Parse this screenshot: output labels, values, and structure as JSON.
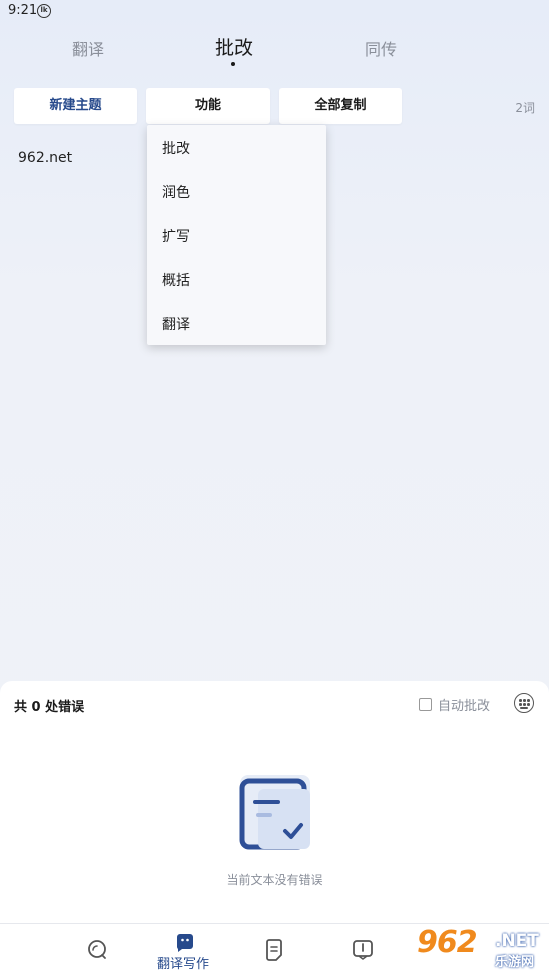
{
  "status_bar": {
    "time": "9:21",
    "indicator_glyph": "lk"
  },
  "top_tabs": [
    {
      "label": "翻译",
      "active": false
    },
    {
      "label": "批改",
      "active": true
    },
    {
      "label": "同传",
      "active": false
    }
  ],
  "toolbar": {
    "new_topic_label": "新建主题",
    "function_label": "功能",
    "copy_all_label": "全部复制",
    "word_count": "2词"
  },
  "editor": {
    "content": "962.net"
  },
  "function_menu": {
    "items": [
      "批改",
      "润色",
      "扩写",
      "概括",
      "翻译"
    ]
  },
  "result_panel": {
    "error_count_text": "共 0 处错误",
    "auto_correct_label": "自动批改",
    "auto_correct_checked": false,
    "empty_message": "当前文本没有错误"
  },
  "bottom_nav": {
    "active_label": "翻译写作",
    "items": [
      {
        "icon": "search-bubble-icon"
      },
      {
        "icon": "translate-writing-icon",
        "label": "翻译写作",
        "active": true
      },
      {
        "icon": "document-icon"
      },
      {
        "icon": "book-icon"
      }
    ]
  },
  "watermark": {
    "number": "962",
    "suffix": ".NET",
    "subtitle": "乐游网"
  },
  "colors": {
    "accent": "#274a8c",
    "muted": "#8a8f9a",
    "watermark_orange": "#f08a1d"
  }
}
